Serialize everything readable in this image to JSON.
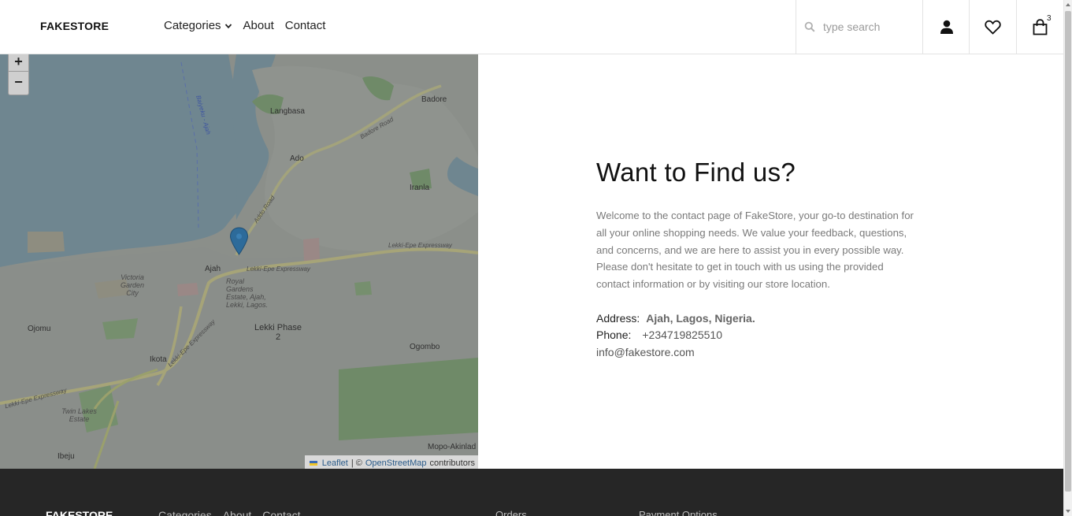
{
  "header": {
    "logo": "FAKESTORE",
    "nav": {
      "categories": "Categories",
      "about": "About",
      "contact": "Contact"
    },
    "search_placeholder": "type search",
    "cart_count": "3"
  },
  "map": {
    "zoom_in": "+",
    "zoom_out": "−",
    "attribution": {
      "leaflet": "Leaflet",
      "separator": "| ©",
      "osm": "OpenStreetMap",
      "contributors": "contributors"
    },
    "labels": {
      "badore": "Badore",
      "langbasa": "Langbasa",
      "ado": "Ado",
      "iranla": "Iranla",
      "ajah": "Ajah",
      "victoria": "Victoria Garden City",
      "royal": "Royal Gardens Estate, Ajah, Lekki, Lagos.",
      "lekki": "Lekki Phase 2",
      "ojomu": "Ojomu",
      "ikota": "Ikota",
      "ogombo": "Ogombo",
      "twinlakes": "Twin Lakes Estate",
      "ibeju": "Ibeju",
      "mopo": "Mopo-Akinlad",
      "lekki_epe_1": "Lekki-Epe Expressway",
      "lekki_epe_2": "Lekki-Epe Expressway",
      "lekki_epe_3": "Lekki-Epe Expressway",
      "lekki_epe_4": "Lekki-Epe Expressway",
      "addo_road": "Addo Road",
      "badore_road": "Badore Road",
      "baiyeku": "Baiyeku - Ajah"
    }
  },
  "content": {
    "title": "Want to Find us?",
    "description": "Welcome to the contact page of FakeStore, your go-to destination for all your online shopping needs. We value your feedback, questions, and concerns, and we are here to assist you in every possible way. Please don't hesitate to get in touch with us using the provided contact information or by visiting our store location.",
    "address_label": "Address:",
    "address_value": "Ajah, Lagos, Nigeria.",
    "phone_label": "Phone:",
    "phone_value": "+234719825510",
    "email": "info@fakestore.com"
  },
  "footer": {
    "logo": "FAKESTORE",
    "nav": {
      "categories": "Categories",
      "about": "About",
      "contact": "Contact"
    },
    "orders": "Orders",
    "payment": "Payment Options"
  }
}
